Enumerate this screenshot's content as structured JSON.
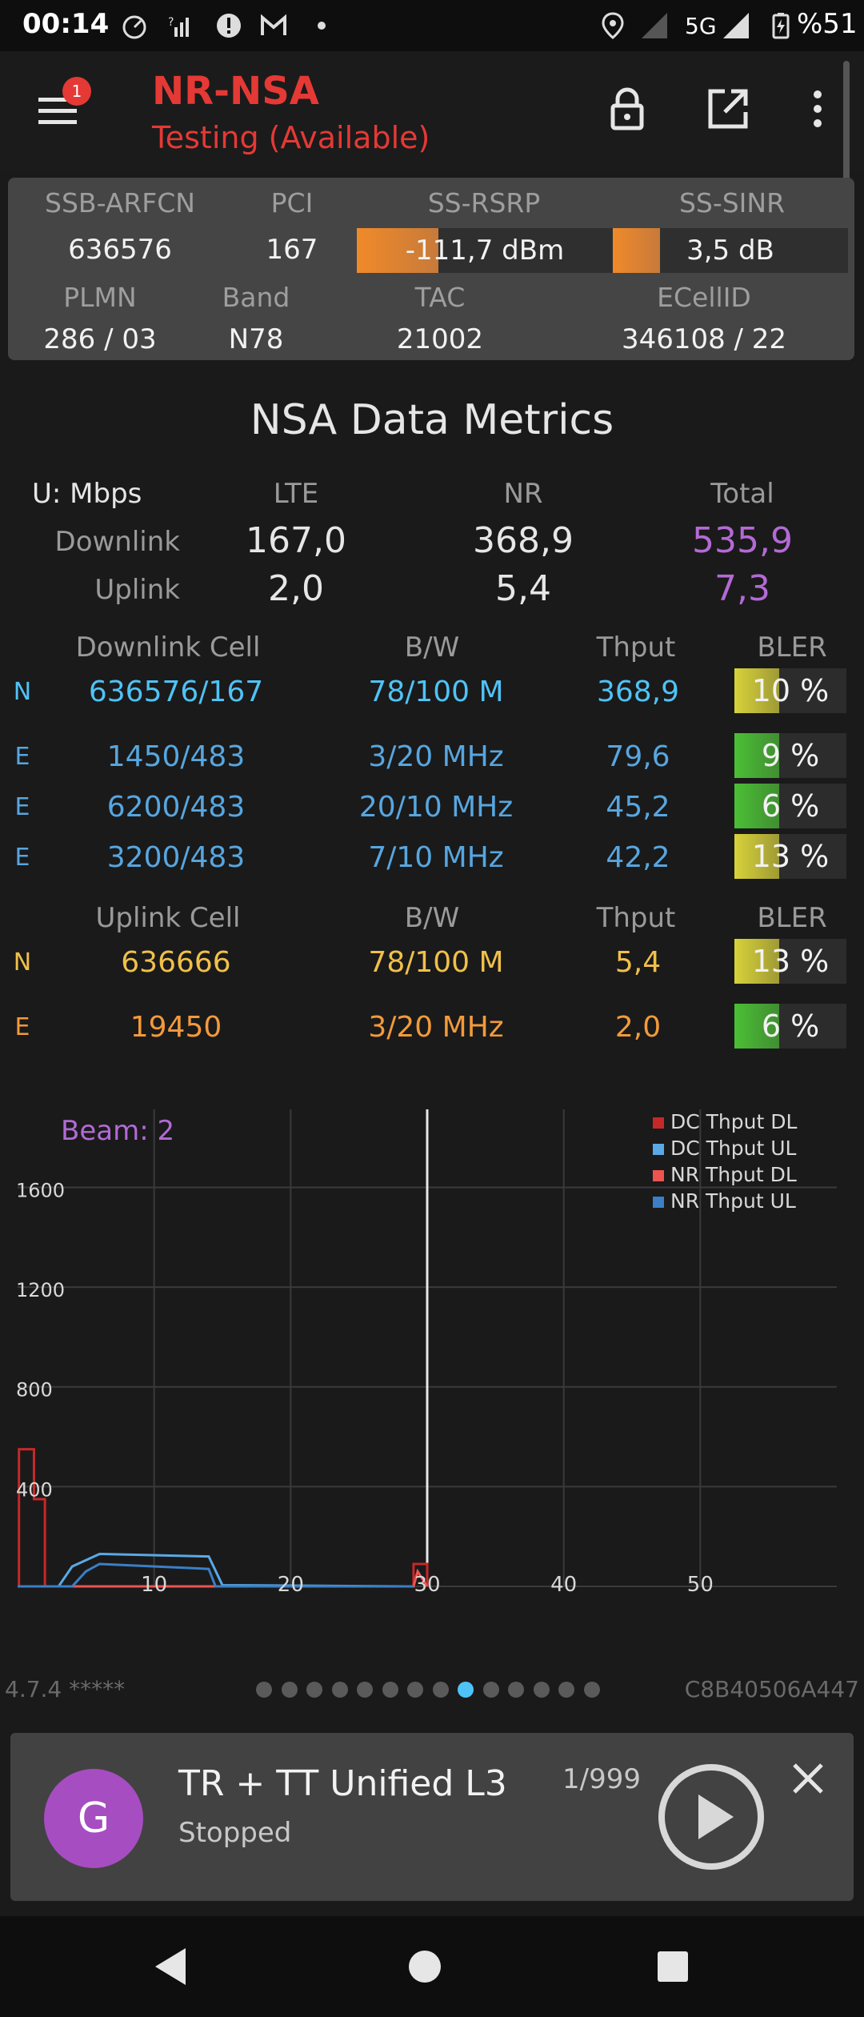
{
  "status_bar": {
    "time": "00:14",
    "network": "5G",
    "battery": "%51",
    "icons": [
      "speedometer-icon",
      "signal-question-icon",
      "alert-circle-icon",
      "gmail-icon",
      "dot-icon",
      "location-icon",
      "signal-icon",
      "signal-icon",
      "battery-charging-icon"
    ]
  },
  "app_bar": {
    "title": "NR-NSA",
    "subtitle": "Testing (Available)",
    "menu_badge": "1",
    "icons": [
      "menu-icon",
      "lock-icon",
      "open-external-icon",
      "more-vert-icon"
    ]
  },
  "cell_panel": {
    "headers1": [
      "SSB-ARFCN",
      "PCI",
      "SS-RSRP",
      "SS-SINR"
    ],
    "values1": [
      "636576",
      "167",
      "-111,7 dBm",
      "3,5 dB"
    ],
    "rsrp_level": 0.32,
    "sinr_level": 0.2,
    "headers2": [
      "PLMN",
      "Band",
      "TAC",
      "ECellID"
    ],
    "values2": [
      "286 / 03",
      "N78",
      "21002",
      "346108 / 22"
    ]
  },
  "metrics": {
    "title": "NSA Data Metrics",
    "unit_label": "U: Mbps",
    "columns": [
      "LTE",
      "NR",
      "Total"
    ],
    "rows": [
      {
        "label": "Downlink",
        "lte": "167,0",
        "nr": "368,9",
        "total": "535,9"
      },
      {
        "label": "Uplink",
        "lte": "2,0",
        "nr": "5,4",
        "total": "7,3"
      }
    ]
  },
  "downlink_table": {
    "headers": [
      "Downlink Cell",
      "B/W",
      "Thput",
      "BLER"
    ],
    "rows": [
      {
        "tech": "N",
        "cell": "636576/167",
        "bw": "78/100 M",
        "thput": "368,9",
        "bler": "10 %",
        "bler_color": "#d8d23a"
      },
      {
        "tech": "E",
        "cell": "1450/483",
        "bw": "3/20 MHz",
        "thput": "79,6",
        "bler": "9 %",
        "bler_color": "#4bbf35"
      },
      {
        "tech": "E",
        "cell": "6200/483",
        "bw": "20/10 MHz",
        "thput": "45,2",
        "bler": "6 %",
        "bler_color": "#4bbf35"
      },
      {
        "tech": "E",
        "cell": "3200/483",
        "bw": "7/10 MHz",
        "thput": "42,2",
        "bler": "13 %",
        "bler_color": "#d8d23a"
      }
    ]
  },
  "uplink_table": {
    "headers": [
      "Uplink Cell",
      "B/W",
      "Thput",
      "BLER"
    ],
    "rows": [
      {
        "tech": "N",
        "cell": "636666",
        "bw": "78/100 M",
        "thput": "5,4",
        "bler": "13 %",
        "bler_color": "#d8d23a"
      },
      {
        "tech": "E",
        "cell": "19450",
        "bw": "3/20 MHz",
        "thput": "2,0",
        "bler": "6 %",
        "bler_color": "#4bbf35"
      }
    ]
  },
  "chart_data": {
    "type": "line",
    "annotation": "Beam: 2",
    "x_ticks": [
      "10",
      "20",
      "30",
      "40",
      "50"
    ],
    "y_ticks": [
      "400",
      "800",
      "1200",
      "1600"
    ],
    "xlim": [
      0,
      60
    ],
    "ylim": [
      0,
      1900
    ],
    "grid": true,
    "legend_position": "top-right",
    "cursor_x": 30,
    "series": [
      {
        "name": "DC Thput DL",
        "color": "#c62828",
        "x": [
          0,
          0.1,
          0.1,
          1.2,
          1.2,
          2,
          2,
          29,
          29,
          30,
          30
        ],
        "y": [
          0,
          0,
          550,
          550,
          350,
          350,
          0,
          0,
          90,
          90,
          0
        ]
      },
      {
        "name": "DC Thput UL",
        "color": "#5aa9e6",
        "x": [
          0,
          3,
          4,
          6,
          14,
          15,
          29
        ],
        "y": [
          0,
          0,
          80,
          130,
          120,
          5,
          0
        ]
      },
      {
        "name": "NR Thput DL",
        "color": "#ef5350",
        "x": [
          0,
          29,
          29.3,
          30
        ],
        "y": [
          0,
          0,
          60,
          0
        ]
      },
      {
        "name": "NR Thput UL",
        "color": "#3a7fc7",
        "x": [
          0,
          4,
          5,
          6,
          14,
          14.5,
          29
        ],
        "y": [
          0,
          0,
          60,
          90,
          70,
          0,
          0
        ]
      }
    ]
  },
  "footer": {
    "version": "4.7.4 *****",
    "device_id": "C8B40506A447",
    "page_count": 14,
    "active_page": 9
  },
  "player": {
    "avatar": "G",
    "title": "TR + TT Unified L3",
    "status": "Stopped",
    "counter": "1/999"
  },
  "nav": {
    "icons": [
      "back-icon",
      "home-icon",
      "recents-icon"
    ]
  }
}
